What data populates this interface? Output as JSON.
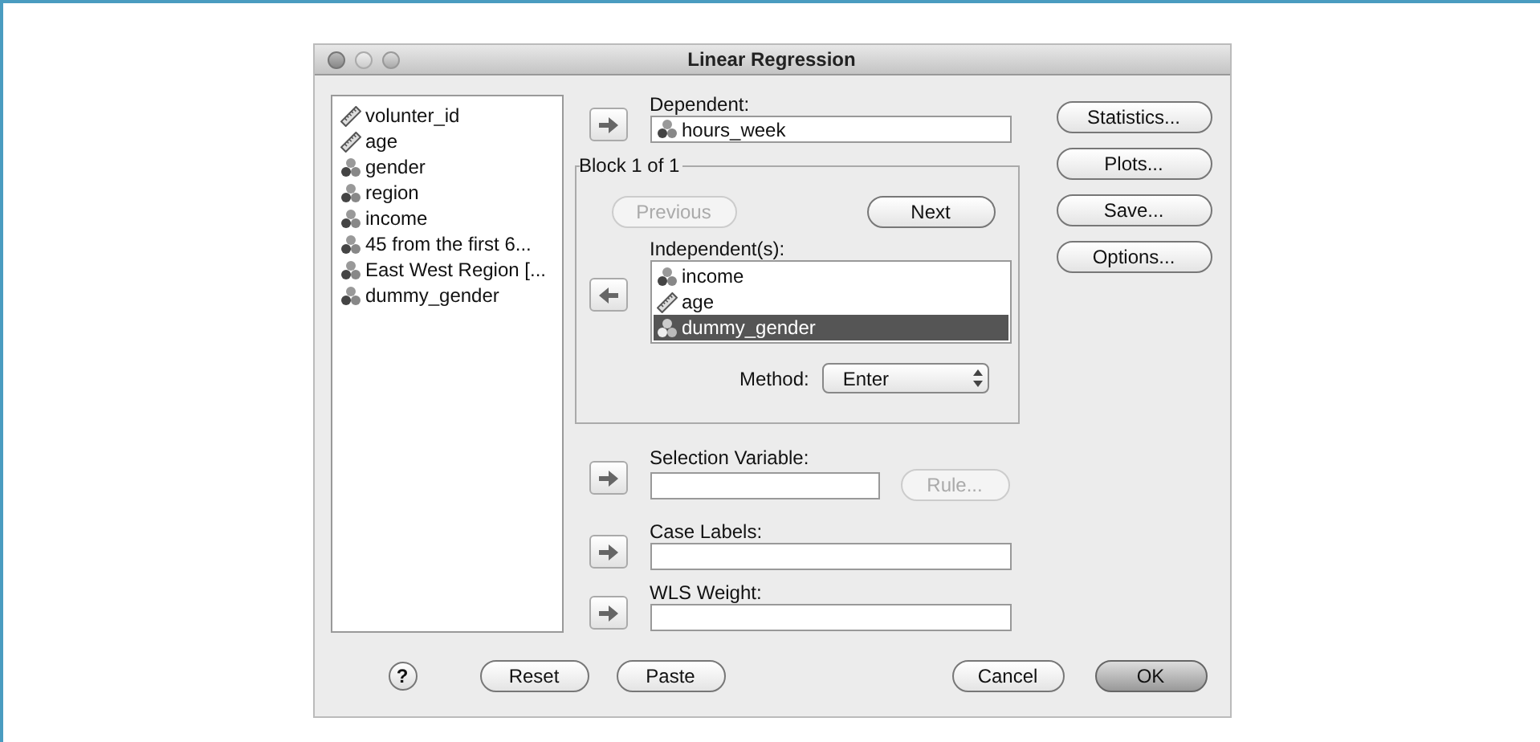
{
  "window": {
    "title": "Linear Regression"
  },
  "variables": [
    {
      "label": "volunter_id",
      "kind": "scale"
    },
    {
      "label": "age",
      "kind": "scale"
    },
    {
      "label": "gender",
      "kind": "nominal"
    },
    {
      "label": "region",
      "kind": "nominal"
    },
    {
      "label": "income",
      "kind": "nominal"
    },
    {
      "label": "45 from the first 6...",
      "kind": "nominal"
    },
    {
      "label": "East West Region [...",
      "kind": "nominal"
    },
    {
      "label": "dummy_gender",
      "kind": "nominal"
    }
  ],
  "dependent": {
    "label": "Dependent:",
    "value": {
      "label": "hours_week",
      "kind": "nominal"
    }
  },
  "block": {
    "title": "Block 1 of 1",
    "previous": {
      "label": "Previous",
      "disabled": true
    },
    "next": {
      "label": "Next",
      "disabled": false
    },
    "independents": {
      "label": "Independent(s):",
      "items": [
        {
          "label": "income",
          "kind": "nominal",
          "selected": false
        },
        {
          "label": "age",
          "kind": "scale",
          "selected": false
        },
        {
          "label": "dummy_gender",
          "kind": "nominal",
          "selected": true
        }
      ]
    },
    "method": {
      "label": "Method:",
      "value": "Enter"
    }
  },
  "selection_variable": {
    "label": "Selection Variable:",
    "rule": {
      "label": "Rule...",
      "disabled": true
    }
  },
  "case_labels": {
    "label": "Case Labels:"
  },
  "wls_weight": {
    "label": "WLS Weight:"
  },
  "side_buttons": [
    "Statistics...",
    "Plots...",
    "Save...",
    "Options..."
  ],
  "footer": {
    "help": "?",
    "buttons": [
      {
        "label": "Reset",
        "default": false
      },
      {
        "label": "Paste",
        "default": false
      },
      {
        "label": "Cancel",
        "default": false
      },
      {
        "label": "OK",
        "default": true
      }
    ]
  }
}
